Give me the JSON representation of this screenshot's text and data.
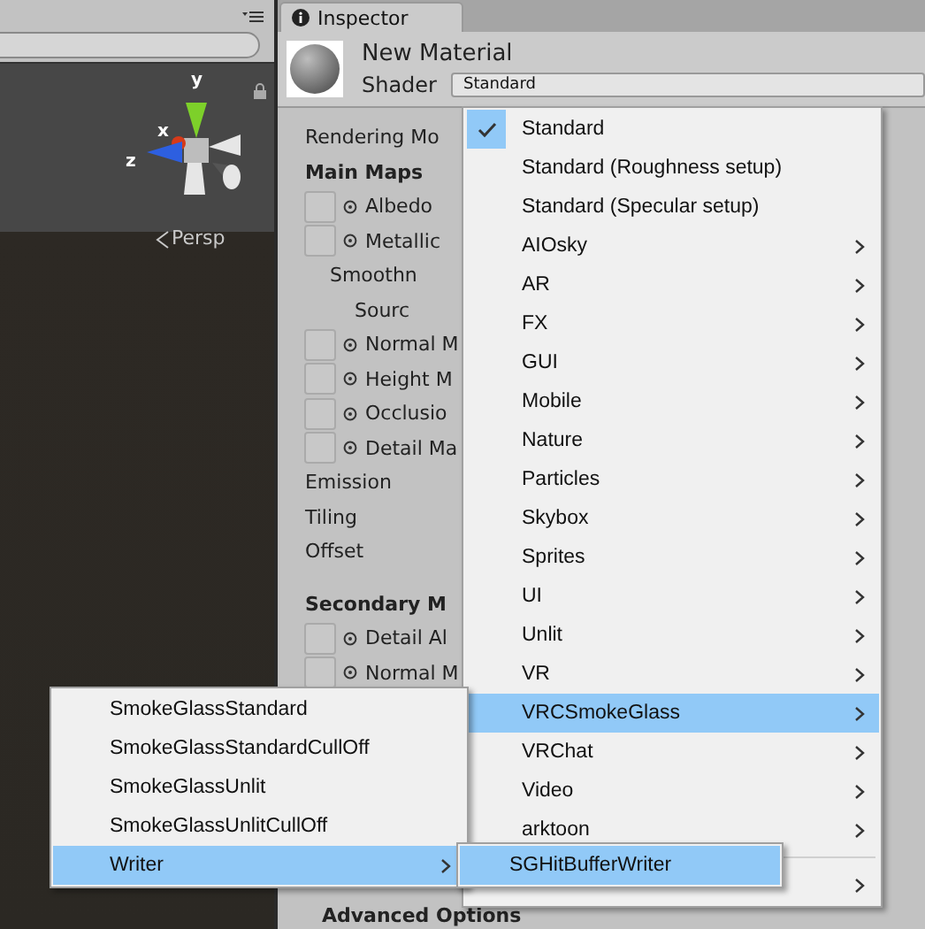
{
  "scene": {
    "gizmo_axes": [
      "y",
      "x",
      "z"
    ],
    "projection": "Persp"
  },
  "inspector": {
    "tab": "Inspector",
    "material": {
      "name": "New Material",
      "shader_label": "Shader",
      "shader_value": "Standard"
    },
    "properties": [
      {
        "kind": "label",
        "label": "Rendering Mo"
      },
      {
        "kind": "header",
        "label": "Main Maps"
      },
      {
        "kind": "texture",
        "label": "Albedo"
      },
      {
        "kind": "texture",
        "label": "Metallic",
        "children": [
          {
            "kind": "label",
            "label": "Smoothn",
            "children": [
              {
                "kind": "label",
                "label": "Sourc"
              }
            ]
          }
        ]
      },
      {
        "kind": "texture",
        "label": "Normal M"
      },
      {
        "kind": "texture",
        "label": "Height M"
      },
      {
        "kind": "texture",
        "label": "Occlusio"
      },
      {
        "kind": "texture",
        "label": "Detail Ma"
      },
      {
        "kind": "label",
        "label": "Emission"
      },
      {
        "kind": "label",
        "label": "Tiling"
      },
      {
        "kind": "label",
        "label": "Offset"
      },
      {
        "kind": "spacer"
      },
      {
        "kind": "header",
        "label": "Secondary M"
      },
      {
        "kind": "texture",
        "label": "Detail Al"
      },
      {
        "kind": "texture",
        "label": "Normal M"
      }
    ],
    "footer": "Advanced Options"
  },
  "shader_menu": {
    "items": [
      {
        "label": "Standard",
        "checked": true,
        "submenu": false,
        "selected": false
      },
      {
        "label": "Standard (Roughness setup)",
        "checked": false,
        "submenu": false,
        "selected": false
      },
      {
        "label": "Standard (Specular setup)",
        "checked": false,
        "submenu": false,
        "selected": false
      },
      {
        "label": "AIOsky",
        "checked": false,
        "submenu": true,
        "selected": false
      },
      {
        "label": "AR",
        "checked": false,
        "submenu": true,
        "selected": false
      },
      {
        "label": "FX",
        "checked": false,
        "submenu": true,
        "selected": false
      },
      {
        "label": "GUI",
        "checked": false,
        "submenu": true,
        "selected": false
      },
      {
        "label": "Mobile",
        "checked": false,
        "submenu": true,
        "selected": false
      },
      {
        "label": "Nature",
        "checked": false,
        "submenu": true,
        "selected": false
      },
      {
        "label": "Particles",
        "checked": false,
        "submenu": true,
        "selected": false
      },
      {
        "label": "Skybox",
        "checked": false,
        "submenu": true,
        "selected": false
      },
      {
        "label": "Sprites",
        "checked": false,
        "submenu": true,
        "selected": false
      },
      {
        "label": "UI",
        "checked": false,
        "submenu": true,
        "selected": false
      },
      {
        "label": "Unlit",
        "checked": false,
        "submenu": true,
        "selected": false
      },
      {
        "label": "VR",
        "checked": false,
        "submenu": true,
        "selected": false
      },
      {
        "label": "VRCSmokeGlass",
        "checked": false,
        "submenu": true,
        "selected": true
      },
      {
        "label": "VRChat",
        "checked": false,
        "submenu": true,
        "selected": false
      },
      {
        "label": "Video",
        "checked": false,
        "submenu": true,
        "selected": false
      },
      {
        "label": "arktoon",
        "checked": false,
        "submenu": true,
        "selected": false
      },
      {
        "kind": "separator"
      },
      {
        "checked": false,
        "submenu": true,
        "selected": false
      }
    ]
  },
  "smokeglass_menu": {
    "items": [
      {
        "label": "SmokeGlassStandard",
        "submenu": false,
        "selected": false
      },
      {
        "label": "SmokeGlassStandardCullOff",
        "submenu": false,
        "selected": false
      },
      {
        "label": "SmokeGlassUnlit",
        "submenu": false,
        "selected": false
      },
      {
        "label": "SmokeGlassUnlitCullOff",
        "submenu": false,
        "selected": false
      },
      {
        "label": "Writer",
        "submenu": true,
        "selected": true
      }
    ]
  },
  "writer_menu": {
    "items": [
      {
        "label": "SGHitBufferWriter",
        "submenu": false,
        "selected": true
      }
    ]
  }
}
